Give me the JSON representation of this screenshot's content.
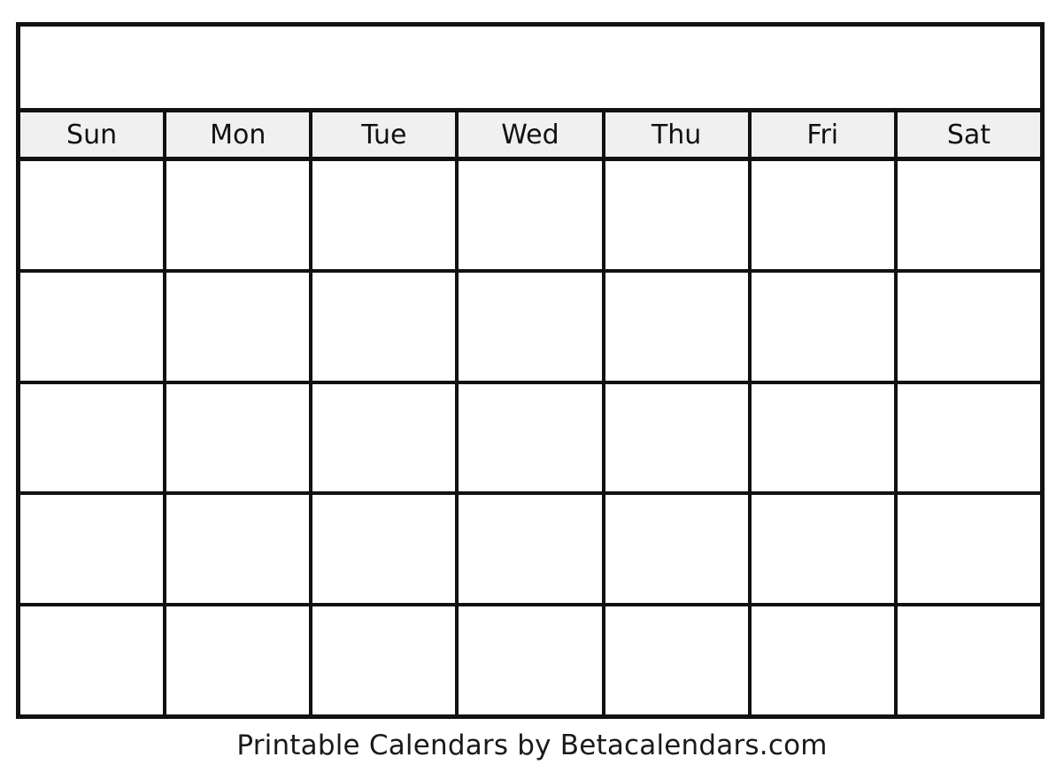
{
  "document": {
    "type": "blank-monthly-calendar",
    "title_banner": {
      "label": ""
    }
  },
  "calendar": {
    "weekday_headers": [
      {
        "label": "Sun"
      },
      {
        "label": "Mon"
      },
      {
        "label": "Tue"
      },
      {
        "label": "Wed"
      },
      {
        "label": "Thu"
      },
      {
        "label": "Fri"
      },
      {
        "label": "Sat"
      }
    ],
    "weeks": [
      {
        "days": [
          "",
          "",
          "",
          "",
          "",
          "",
          ""
        ]
      },
      {
        "days": [
          "",
          "",
          "",
          "",
          "",
          "",
          ""
        ]
      },
      {
        "days": [
          "",
          "",
          "",
          "",
          "",
          "",
          ""
        ]
      },
      {
        "days": [
          "",
          "",
          "",
          "",
          "",
          "",
          ""
        ]
      },
      {
        "days": [
          "",
          "",
          "",
          "",
          "",
          "",
          ""
        ]
      }
    ],
    "week_count": 5,
    "column_count": 7
  },
  "footer": {
    "credit": "Printable Calendars by Betacalendars.com"
  },
  "colors": {
    "border": "#111111",
    "header_background": "#f0f0f0",
    "cell_background": "#ffffff",
    "page_background": "#ffffff",
    "text": "#111111"
  }
}
